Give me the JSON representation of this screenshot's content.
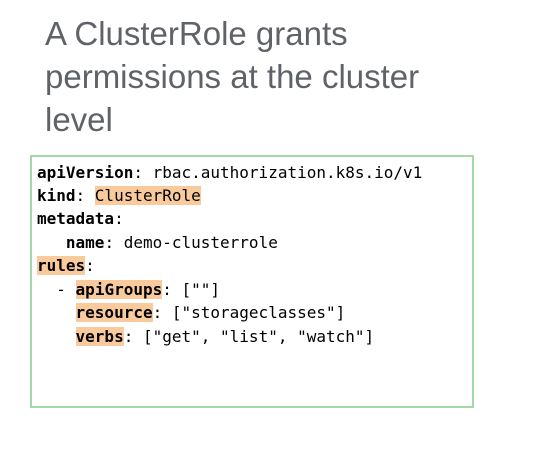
{
  "slide": {
    "title_lines": [
      "A ClusterRole grants",
      "permissions at the cluster",
      "level"
    ]
  },
  "code": {
    "apiVersion_key": "apiVersion",
    "apiVersion_value": "rbac.authorization.k8s.io/v1",
    "kind_key": "kind",
    "kind_value": "ClusterRole",
    "metadata_key": "metadata",
    "name_key": "name",
    "name_value": "demo-clusterrole",
    "rules_key": "rules",
    "dash": "-",
    "apiGroups_key": "apiGroups",
    "apiGroups_value": "[\"\"]",
    "resource_key": "resource",
    "resource_value": "[\"storageclasses\"]",
    "verbs_key": "verbs",
    "verbs_value": "[\"get\", \"list\", \"watch\"]",
    "highlight_color": "#f9cb9c",
    "border_color": "#a3d9a5"
  }
}
